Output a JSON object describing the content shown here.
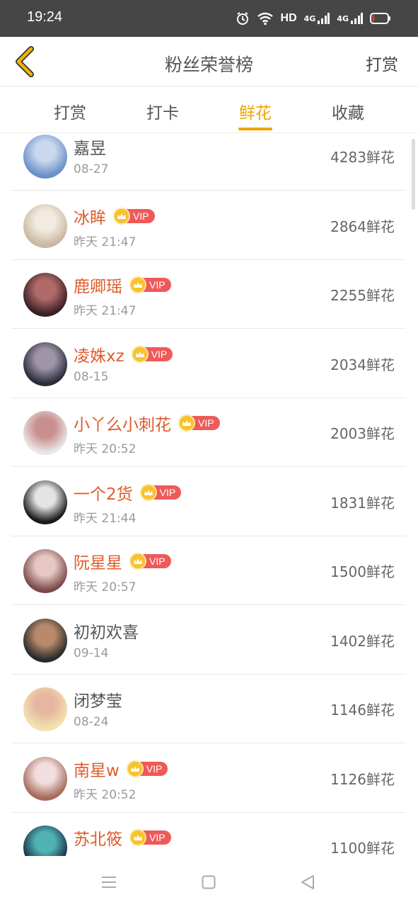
{
  "status_bar": {
    "time": "19:24",
    "network_label": "HD",
    "signal1_label": "4G",
    "signal2_label": "4G",
    "icons": [
      "alarm-icon",
      "wifi-icon",
      "signal-icon",
      "signal-icon",
      "battery-icon"
    ],
    "battery_level": 0.15,
    "battery_color": "#e53935"
  },
  "nav": {
    "back_icon": "chevron-left-icon",
    "title": "粉丝荣誉榜",
    "action_label": "打赏",
    "accent_color": "#f0a400"
  },
  "tabs": [
    {
      "label": "打赏",
      "active": false
    },
    {
      "label": "打卡",
      "active": false
    },
    {
      "label": "鲜花",
      "active": true
    },
    {
      "label": "收藏",
      "active": false
    }
  ],
  "ranking": [
    {
      "name": "嘉昱",
      "vip": false,
      "vip_label": "",
      "time": "08-27",
      "amount": "4283鲜花",
      "avatar_colors": [
        "#6a8fc7",
        "#c9d8ee"
      ]
    },
    {
      "name": "冰眸",
      "vip": true,
      "vip_label": "VIP",
      "time": "昨天 21:47",
      "amount": "2864鲜花",
      "avatar_colors": [
        "#c9b8a0",
        "#f2ebe0"
      ]
    },
    {
      "name": "鹿卿瑶",
      "vip": true,
      "vip_label": "VIP",
      "time": "昨天 21:47",
      "amount": "2255鲜花",
      "avatar_colors": [
        "#3a1f24",
        "#b06a6a"
      ]
    },
    {
      "name": "凌姝xz",
      "vip": true,
      "vip_label": "VIP",
      "time": "08-15",
      "amount": "2034鲜花",
      "avatar_colors": [
        "#2c2c3a",
        "#9e95a8"
      ]
    },
    {
      "name": "小丫么小刺花",
      "vip": true,
      "vip_label": "VIP",
      "time": "昨天 20:52",
      "amount": "2003鲜花",
      "avatar_colors": [
        "#e8e6e6",
        "#c98f8f"
      ]
    },
    {
      "name": "一个2货",
      "vip": true,
      "vip_label": "VIP",
      "time": "昨天 21:44",
      "amount": "1831鲜花",
      "avatar_colors": [
        "#1a1a1a",
        "#e4e4e4"
      ]
    },
    {
      "name": "阮星星",
      "vip": true,
      "vip_label": "VIP",
      "time": "昨天 20:57",
      "amount": "1500鲜花",
      "avatar_colors": [
        "#7a4a4a",
        "#e7c7c2"
      ]
    },
    {
      "name": "初初欢喜",
      "vip": false,
      "vip_label": "",
      "time": "09-14",
      "amount": "1402鲜花",
      "avatar_colors": [
        "#2a2a2a",
        "#b88a6b"
      ]
    },
    {
      "name": "闭梦莹",
      "vip": false,
      "vip_label": "",
      "time": "08-24",
      "amount": "1146鲜花",
      "avatar_colors": [
        "#f3e2b0",
        "#e6b7a0"
      ]
    },
    {
      "name": "南星w",
      "vip": true,
      "vip_label": "VIP",
      "time": "昨天 20:52",
      "amount": "1126鲜花",
      "avatar_colors": [
        "#a56b5a",
        "#f2dede"
      ]
    },
    {
      "name": "苏北筱",
      "vip": true,
      "vip_label": "VIP",
      "time": "",
      "amount": "1100鲜花",
      "avatar_colors": [
        "#1d2d44",
        "#4fb3b3"
      ]
    }
  ],
  "bottom_nav": [
    {
      "icon": "menu-icon"
    },
    {
      "icon": "home-square-icon"
    },
    {
      "icon": "back-triangle-icon"
    }
  ]
}
